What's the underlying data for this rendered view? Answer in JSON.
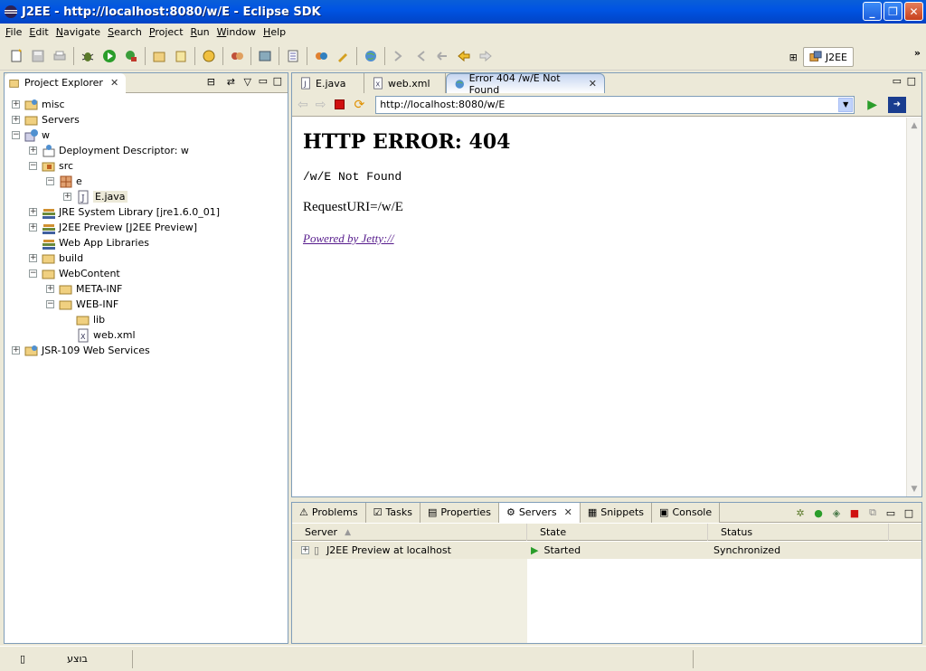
{
  "window": {
    "title": "J2EE - http://localhost:8080/w/E - Eclipse SDK",
    "buttons": [
      "minimize",
      "maximize",
      "close"
    ]
  },
  "menu": [
    "File",
    "Edit",
    "Navigate",
    "Search",
    "Project",
    "Run",
    "Window",
    "Help"
  ],
  "perspective": {
    "label": "J2EE"
  },
  "explorer": {
    "tab_label": "Project Explorer",
    "tree": [
      {
        "label": "misc",
        "depth": 0,
        "exp": "+"
      },
      {
        "label": "Servers",
        "depth": 0,
        "exp": "+"
      },
      {
        "label": "w",
        "depth": 0,
        "exp": "-"
      },
      {
        "label": "Deployment Descriptor: w",
        "depth": 1,
        "exp": "+"
      },
      {
        "label": "src",
        "depth": 1,
        "exp": "-"
      },
      {
        "label": "e",
        "depth": 2,
        "exp": "-"
      },
      {
        "label": "E.java",
        "depth": 3,
        "exp": "+"
      },
      {
        "label": "JRE System Library [jre1.6.0_01]",
        "depth": 1,
        "exp": "+"
      },
      {
        "label": "J2EE Preview [J2EE Preview]",
        "depth": 1,
        "exp": "+"
      },
      {
        "label": "Web App Libraries",
        "depth": 1,
        "exp": ""
      },
      {
        "label": "build",
        "depth": 1,
        "exp": "+"
      },
      {
        "label": "WebContent",
        "depth": 1,
        "exp": "-"
      },
      {
        "label": "META-INF",
        "depth": 2,
        "exp": "+"
      },
      {
        "label": "WEB-INF",
        "depth": 2,
        "exp": "-"
      },
      {
        "label": "lib",
        "depth": 3,
        "exp": ""
      },
      {
        "label": "web.xml",
        "depth": 3,
        "exp": ""
      },
      {
        "label": "JSR-109 Web Services",
        "depth": 0,
        "exp": "+"
      }
    ]
  },
  "editor": {
    "tabs": [
      {
        "label": "E.java",
        "icon": "java-file-icon"
      },
      {
        "label": "web.xml",
        "icon": "xml-file-icon"
      },
      {
        "label": "Error 404 /w/E Not Found",
        "icon": "globe-icon",
        "active": true
      }
    ],
    "url": "http://localhost:8080/w/E",
    "page": {
      "heading": "HTTP ERROR: 404",
      "message": "/w/E Not Found",
      "request_uri": "RequestURI=/w/E",
      "powered_by": "Powered by Jetty://"
    }
  },
  "bottom": {
    "tabs": [
      "Problems",
      "Tasks",
      "Properties",
      "Servers",
      "Snippets",
      "Console"
    ],
    "active_tab": "Servers",
    "columns": [
      "Server",
      "State",
      "Status"
    ],
    "rows": [
      {
        "server": "J2EE Preview at localhost",
        "state": "Started",
        "status": "Synchronized"
      }
    ]
  },
  "statusbar": {
    "text": "בוצע"
  }
}
